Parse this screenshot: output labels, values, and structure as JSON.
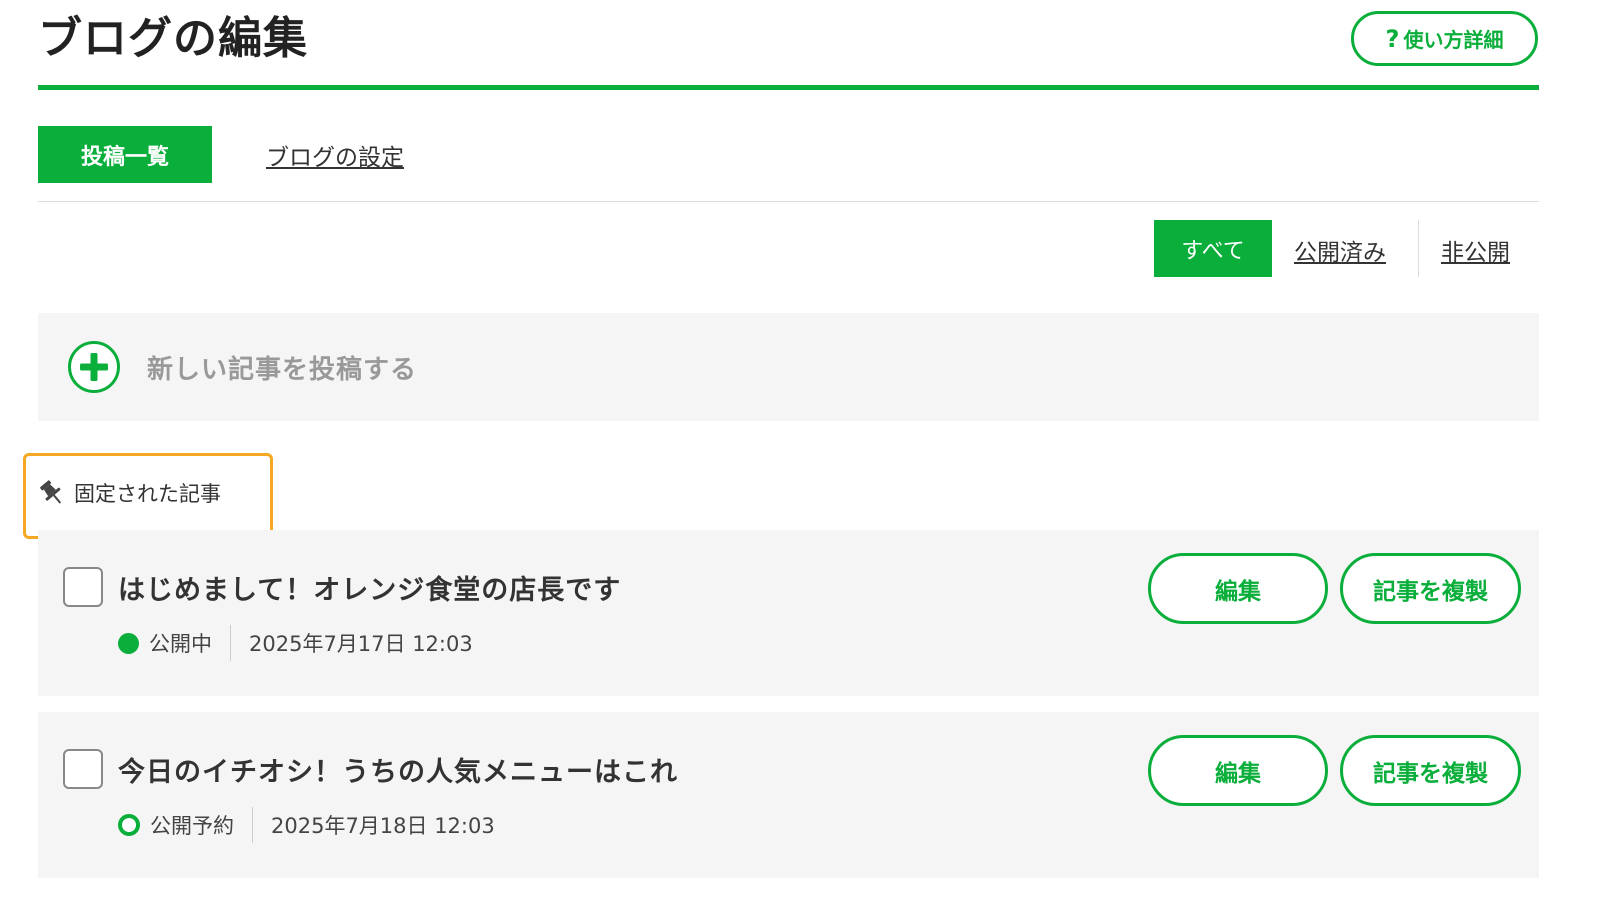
{
  "header": {
    "title": "ブログの編集",
    "help_icon": "?",
    "help_label": "使い方詳細"
  },
  "tabs": {
    "posts_label": "投稿一覧",
    "settings_label": "ブログの設定"
  },
  "filters": {
    "all": "すべて",
    "published": "公開済み",
    "private": "非公開"
  },
  "new_post": {
    "icon": "plus-circle-icon",
    "label": "新しい記事を投稿する"
  },
  "pinned": {
    "icon": "pin-icon",
    "label": "固定された記事"
  },
  "posts": [
    {
      "title": "はじめまして！オレンジ食堂の店長です",
      "status": "公開中",
      "status_icon": "published-dot-icon",
      "date": "2025年7月17日 12:03",
      "edit_label": "編集",
      "copy_label": "記事を複製"
    },
    {
      "title": "今日のイチオシ！うちの人気メニューはこれ",
      "status": "公開予約",
      "status_icon": "scheduled-ring-icon",
      "date": "2025年7月18日 12:03",
      "edit_label": "編集",
      "copy_label": "記事を複製"
    }
  ],
  "colors": {
    "accent": "#0aae3a",
    "highlight": "#f5a623",
    "panel_bg": "#f5f5f5",
    "muted_text": "#999999"
  }
}
